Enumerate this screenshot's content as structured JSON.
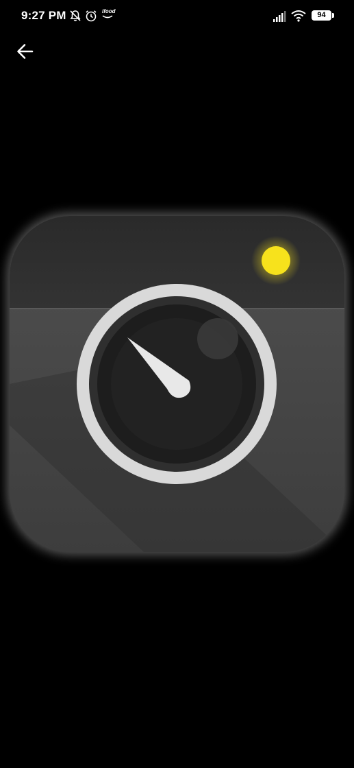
{
  "status_bar": {
    "time": "9:27 PM",
    "notification_icons": [
      "bell-off-icon",
      "alarm-clock-icon",
      "ifood-app-icon"
    ],
    "ifood_label": "ifood",
    "system_icons": [
      "signal-icon",
      "wifi-icon",
      "battery-icon"
    ],
    "battery_level": "94"
  },
  "toolbar": {
    "back_icon": "arrow-left-icon"
  },
  "viewer": {
    "image_subject": "camera-app-icon",
    "colors": {
      "background": "#000000",
      "body_top": "#2e2e2e",
      "body_bottom": "#484848",
      "lens_ring": "#d9d9d9",
      "flash": "#f7e21c"
    }
  }
}
